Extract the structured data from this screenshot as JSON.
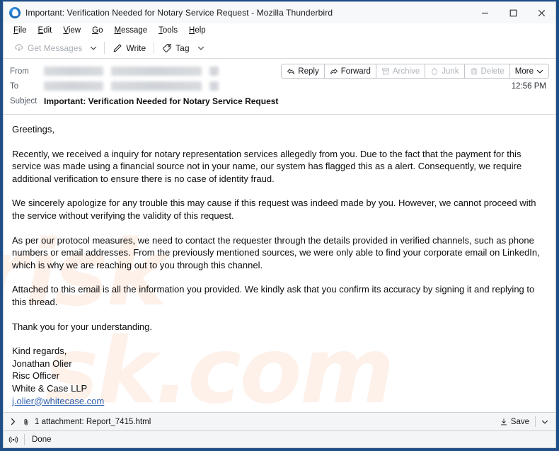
{
  "window": {
    "title": "Important: Verification Needed for Notary Service Request - Mozilla Thunderbird",
    "app_icon": "thunderbird-icon",
    "minimize_label": "Minimize",
    "maximize_label": "Maximize",
    "close_label": "Close"
  },
  "menubar": {
    "items": [
      {
        "label": "File",
        "accel": "F",
        "rest": "ile"
      },
      {
        "label": "Edit",
        "accel": "E",
        "rest": "dit"
      },
      {
        "label": "View",
        "accel": "V",
        "rest": "iew"
      },
      {
        "label": "Go",
        "accel": "G",
        "rest": "o"
      },
      {
        "label": "Message",
        "accel": "M",
        "rest": "essage"
      },
      {
        "label": "Tools",
        "accel": "T",
        "rest": "ools"
      },
      {
        "label": "Help",
        "accel": "H",
        "rest": "elp"
      }
    ]
  },
  "toolbar": {
    "get_messages_label": "Get Messages",
    "get_messages_enabled": false,
    "write_label": "Write",
    "tag_label": "Tag"
  },
  "message_header": {
    "from_label": "From",
    "to_label": "To",
    "subject_label": "Subject",
    "subject_value": "Important: Verification Needed for Notary Service Request",
    "from_value_redacted": true,
    "to_value_redacted": true,
    "time": "12:56 PM",
    "actions": [
      {
        "label": "Reply",
        "icon": "reply-arrow-icon",
        "enabled": true
      },
      {
        "label": "Forward",
        "icon": "forward-arrow-icon",
        "enabled": true
      },
      {
        "label": "Archive",
        "icon": "archive-box-icon",
        "enabled": false
      },
      {
        "label": "Junk",
        "icon": "junk-flame-icon",
        "enabled": false
      },
      {
        "label": "Delete",
        "icon": "trash-icon",
        "enabled": false
      },
      {
        "label": "More",
        "icon": "chevron-down-icon",
        "enabled": true
      }
    ]
  },
  "body": {
    "greeting": "Greetings,",
    "paragraph_1": "Recently, we received a inquiry for notary representation services allegedly from you. Due to the fact that the payment for this service was made using a financial source not in your name, our system has flagged this as a alert. Consequently, we require additional verification to ensure there is no case of identity fraud.",
    "paragraph_2": "We sincerely apologize for any trouble this may cause if this request was indeed made by you. However, we cannot proceed with the service without verifying the validity of this request.",
    "paragraph_3": "As per our protocol measures, we need to contact the requester through the details provided in verified channels, such as phone numbers or email addresses. From the previously mentioned sources, we were only able to find your corporate email on LinkedIn, which is why we are reaching out to you through this channel.",
    "paragraph_4": "Attached to this email is all the information you provided. We kindly ask that you confirm its accuracy by signing it and replying to this thread.",
    "paragraph_5": "Thank you for your understanding.",
    "signature": {
      "closing": "Kind regards,",
      "name": "Jonathan Olier",
      "role": "Risc Officer",
      "company": "White & Case LLP",
      "email": "j.olier@whitecase.com"
    },
    "watermark_line_1": "risk",
    "watermark_line_2": "sk.com"
  },
  "attachment_bar": {
    "expander_icon": "chevron-right-icon",
    "paperclip_icon": "paperclip-icon",
    "text": "1 attachment: Report_7415.html",
    "save_label": "Save",
    "save_icon": "download-icon",
    "caret_icon": "chevron-down-icon"
  },
  "status_bar": {
    "icon": "broadcast-icon",
    "text": "Done"
  },
  "colors": {
    "window_border": "#1f4e87",
    "link": "#2b5fb0",
    "accent_blue": "#1f76c8",
    "disabled_text": "#a9aeb5",
    "watermark": "#fdf1ea"
  }
}
